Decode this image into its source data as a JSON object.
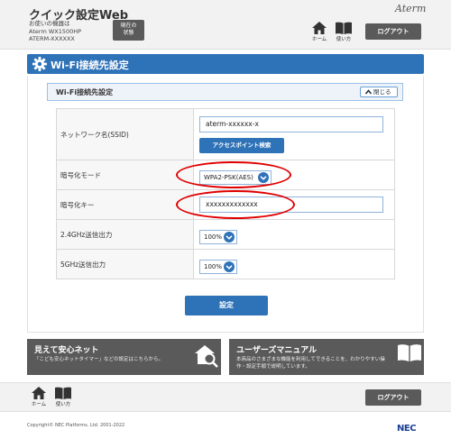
{
  "header": {
    "title": "クイック設定Web",
    "device_label": "お使いの機器は",
    "device_model": "Aterm WX1500HP",
    "device_name": "ATERM-XXXXXX",
    "status_button": "現在の\n状態",
    "brand": "Aterm",
    "home_label": "ホーム",
    "help_label": "使い方",
    "logout_label": "ログアウト"
  },
  "section": {
    "title": "Wi-Fi接続先設定",
    "subtitle": "Wi-Fi接続先設定",
    "close_label": "閉じる"
  },
  "form": {
    "ssid_label": "ネットワーク名(SSID)",
    "ssid_value": "aterm-xxxxxx-x",
    "scan_button": "アクセスポイント検索",
    "encryption_label": "暗号化モード",
    "encryption_value": "WPA2-PSK(AES)",
    "key_label": "暗号化キー",
    "key_value": "xxxxxxxxxxxxx",
    "power24_label": "2.4GHz送信出力",
    "power24_value": "100%",
    "power5_label": "5GHz送信出力",
    "power5_value": "100%",
    "set_button": "設定"
  },
  "tiles": {
    "left_title": "見えて安心ネット",
    "left_desc": "「こども安心ネットタイマー」などの設定はこちらから。",
    "right_title": "ユーザーズマニュアル",
    "right_desc_1": "本商品のさまざまな機能を利用してできることを、わかりやすい操",
    "right_desc_2": "作・設定手順で説明しています。"
  },
  "footer": {
    "home_label": "ホーム",
    "help_label": "使い方",
    "logout_label": "ログアウト",
    "copyright": "Copyright© NEC Platforms, Ltd. 2001-2022",
    "logo": "NEC"
  },
  "colors": {
    "accent": "#2e72b8",
    "dark_button": "#5a5a5a",
    "highlight": "#e00000"
  }
}
